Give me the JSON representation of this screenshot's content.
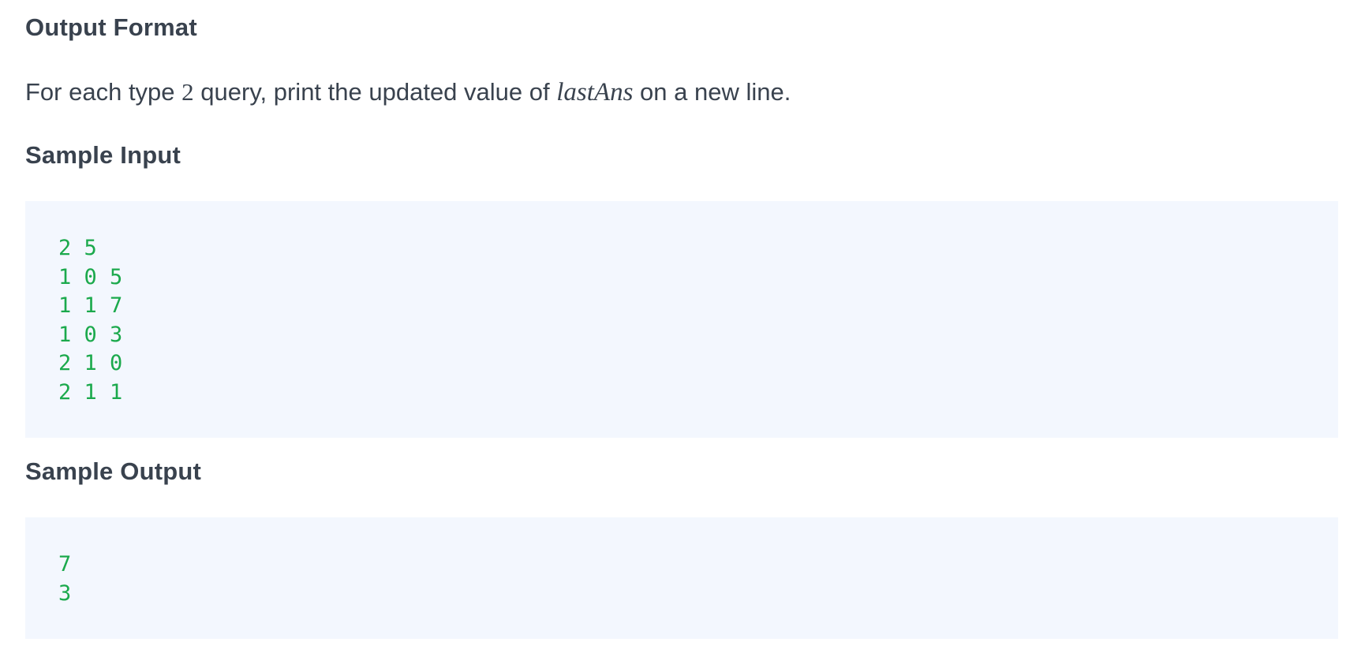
{
  "output_format": {
    "heading": "Output Format",
    "text_before": "For each type ",
    "type_number": "2",
    "text_middle": " query, print the updated value of ",
    "variable": "lastAns",
    "text_after": " on a new line."
  },
  "sample_input": {
    "heading": "Sample Input",
    "lines": [
      "2 5",
      "1 0 5",
      "1 1 7",
      "1 0 3",
      "2 1 0",
      "2 1 1"
    ]
  },
  "sample_output": {
    "heading": "Sample Output",
    "lines": [
      "7",
      "3"
    ]
  },
  "colors": {
    "heading_text": "#39424e",
    "code_text": "#1ba94c",
    "code_background": "#f3f7fe"
  }
}
